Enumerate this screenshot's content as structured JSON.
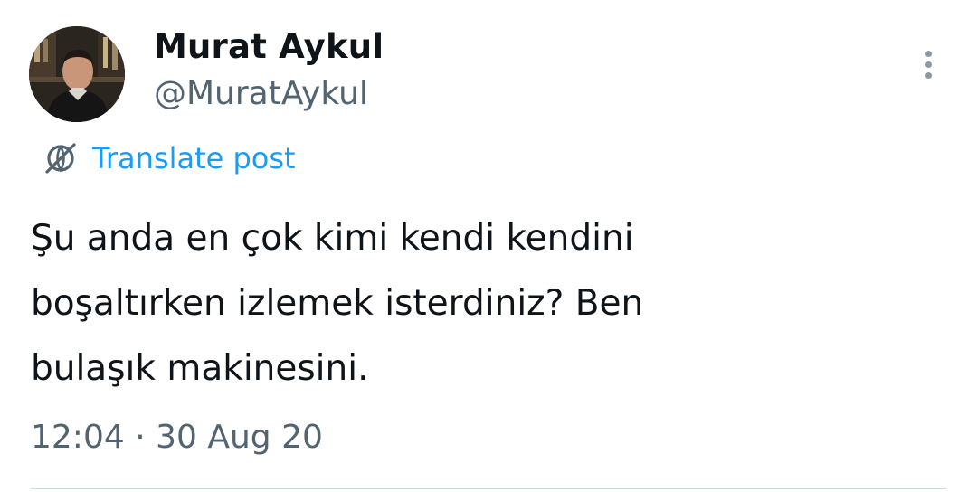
{
  "author": {
    "display_name": "Murat Aykul",
    "handle": "@MuratAykul",
    "avatar": "profile-photo"
  },
  "header": {
    "more_icon": "more-vertical-icon"
  },
  "translate": {
    "icon": "globe-translate-icon",
    "label": "Translate post",
    "color": "#1d9bf0"
  },
  "post": {
    "lines": [
      "Şu anda en çok kimi kendi kendini",
      "boşaltırken izlemek isterdiniz? Ben",
      "bulaşık makinesini."
    ]
  },
  "meta": {
    "time": "12:04",
    "separator": " · ",
    "date": "30 Aug 20"
  },
  "colors": {
    "text": "#0f1419",
    "secondary": "#536471",
    "accent": "#1d9bf0",
    "divider": "#cfd9de"
  }
}
